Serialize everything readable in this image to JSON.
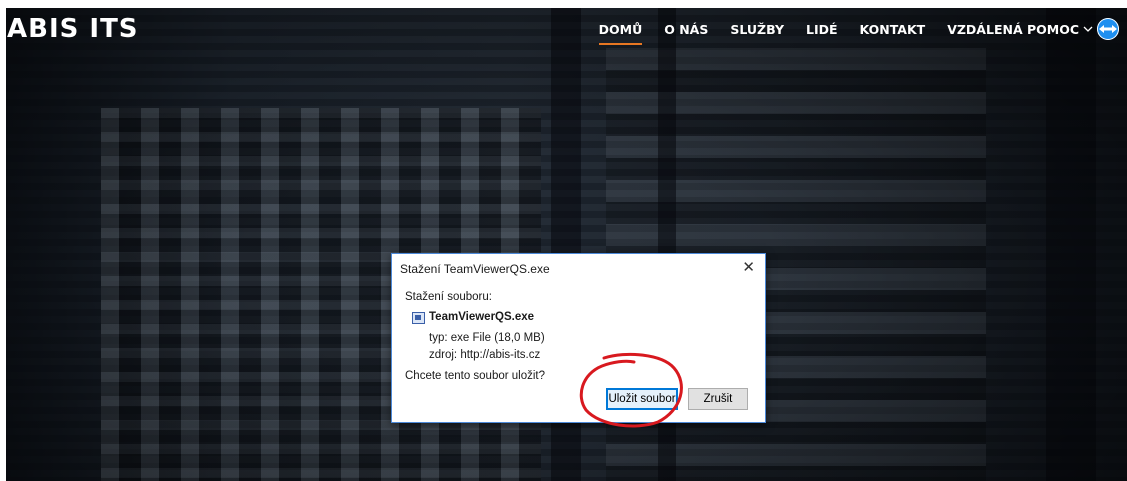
{
  "header": {
    "logo": "ABIS ITS",
    "nav": [
      {
        "label": "DOMŮ",
        "active": true
      },
      {
        "label": "O NÁS"
      },
      {
        "label": "SLUŽBY"
      },
      {
        "label": "LIDÉ"
      },
      {
        "label": "KONTAKT"
      },
      {
        "label": "VZDÁLENÁ POMOC"
      }
    ],
    "accent_color": "#e87722",
    "remote_help_icon": "teamviewer-icon"
  },
  "dialog": {
    "title": "Stažení TeamViewerQS.exe",
    "close_glyph": "✕",
    "label": "Stažení souboru:",
    "file_name": "TeamViewerQS.exe",
    "type_line": "typ: exe File (18,0 MB)",
    "source_line": "zdroj:  http://abis-its.cz",
    "question": "Chcete tento soubor uložit?",
    "save_button": "Uložit soubor",
    "cancel_button": "Zrušit",
    "annotation_color": "#d8191f"
  }
}
